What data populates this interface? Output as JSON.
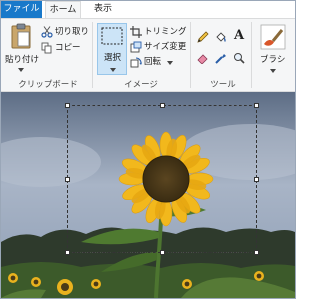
{
  "tabs": {
    "file": "ファイル",
    "home": "ホーム",
    "view": "表示"
  },
  "clipboard": {
    "paste": "貼り付け",
    "cut": "切り取り",
    "copy": "コピー",
    "label": "クリップボード"
  },
  "image": {
    "select": "選択",
    "crop": "トリミング",
    "resize": "サイズ変更",
    "rotate": "回転",
    "label": "イメージ"
  },
  "tools": {
    "label": "ツール",
    "text_tool_glyph": "A"
  },
  "brushes": {
    "label": "ブラシ"
  },
  "colors": {
    "file_tab": "#1979ca",
    "sky_top": "#5f6f87",
    "sky_mid": "#aab6c8",
    "petal": "#f2b81c",
    "center": "#4a3a18",
    "leaf": "#3f6b2c"
  }
}
